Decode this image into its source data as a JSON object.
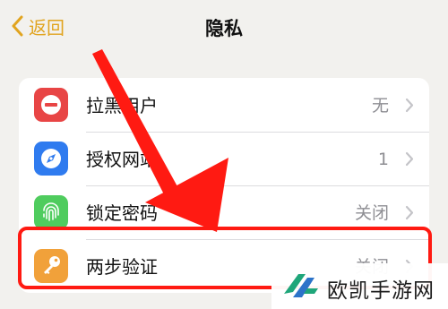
{
  "nav": {
    "back_label": "返回",
    "title": "隐私"
  },
  "accent_color": "#e1a41f",
  "highlight_color": "#ff1a12",
  "rows": [
    {
      "label": "拉黑用户",
      "value": "无",
      "icon": "block-icon",
      "icon_color": "#e84545"
    },
    {
      "label": "授权网站",
      "value": "1",
      "icon": "compass-icon",
      "icon_color": "#2f7bef"
    },
    {
      "label": "锁定密码",
      "value": "关闭",
      "icon": "fingerprint-icon",
      "icon_color": "#4fcc5e"
    },
    {
      "label": "两步验证",
      "value": "关闭",
      "icon": "key-icon",
      "icon_color": "#f1a13a"
    }
  ],
  "watermark": {
    "text": "欧凯手游网",
    "logo": "ok-logo"
  }
}
